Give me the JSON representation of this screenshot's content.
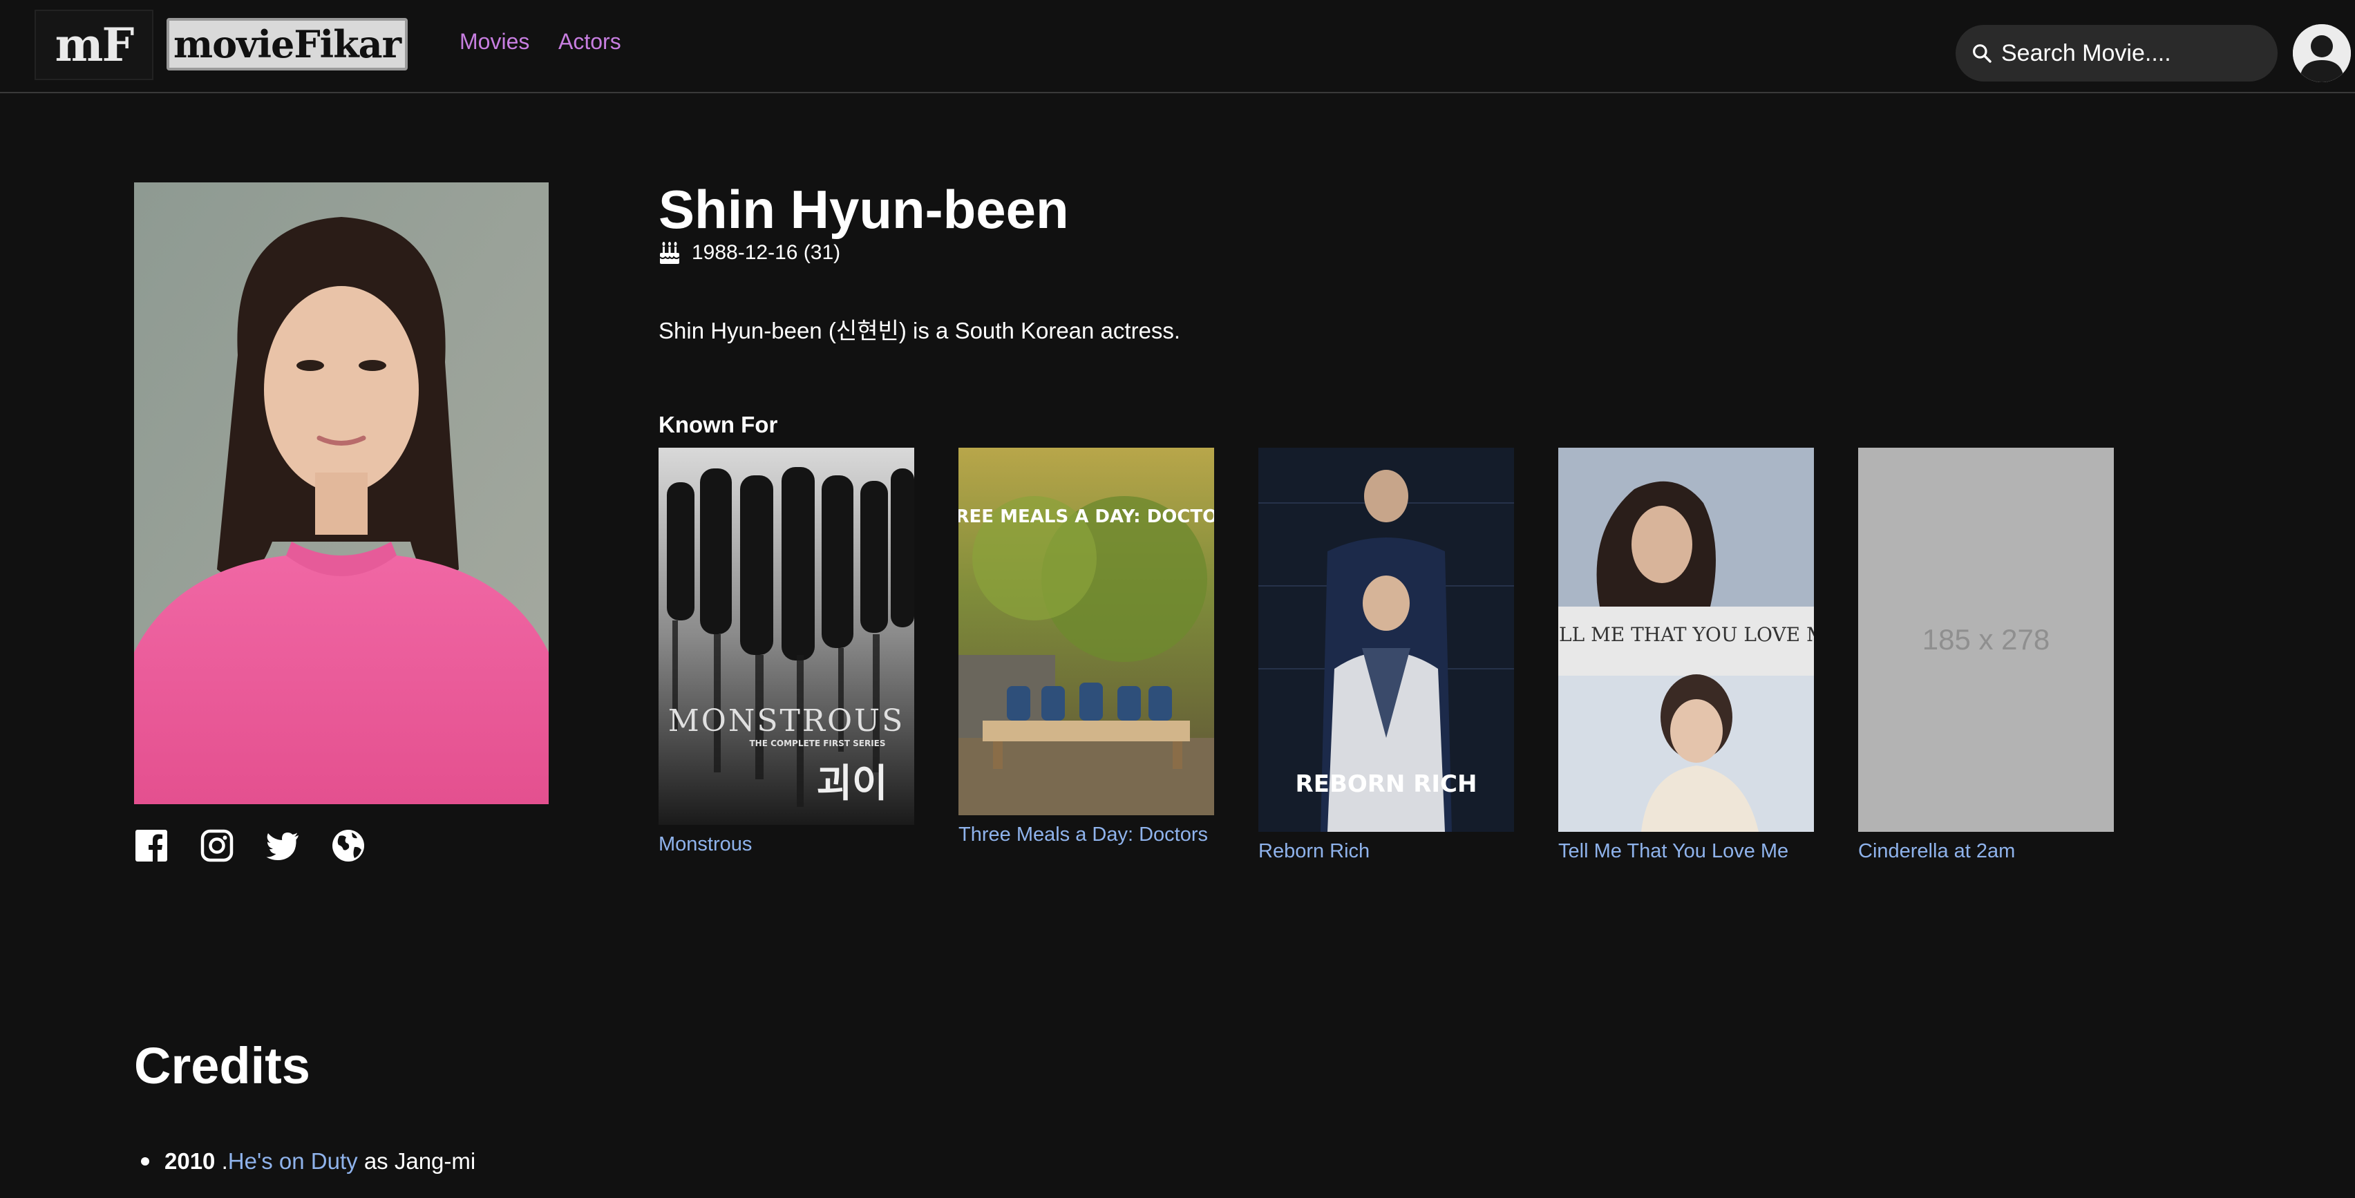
{
  "nav": {
    "logo_short": "mF",
    "logo_word": "movieFikar",
    "links": [
      "Movies",
      "Actors"
    ],
    "search_placeholder": "Search Movie....",
    "accent": "#c77ee0"
  },
  "actor": {
    "name": "Shin Hyun-been",
    "birth": "1988-12-16 (31)",
    "bio": "Shin Hyun-been (신현빈) is a South Korean actress.",
    "social_icons": [
      "facebook-icon",
      "instagram-icon",
      "twitter-icon",
      "globe-icon"
    ]
  },
  "known_for": {
    "heading": "Known For",
    "movies": [
      {
        "title": "Monstrous",
        "poster_text": "MONSTROUS",
        "poster_sub": "THE COMPLETE FIRST SERIES",
        "poster_korean": "괴이"
      },
      {
        "title": "Three Meals a Day: Doctors",
        "poster_text": "THREE MEALS A DAY: DOCTORS"
      },
      {
        "title": "Reborn Rich",
        "poster_text": "REBORN RICH"
      },
      {
        "title": "Tell Me That You Love Me",
        "poster_text": "TELL ME THAT YOU LOVE ME"
      },
      {
        "title": "Cinderella at 2am",
        "poster_text": "185 x 278"
      }
    ],
    "link_color": "#8fb3ec"
  },
  "credits": {
    "heading": "Credits",
    "items": [
      {
        "year": "2010",
        "sep": " .",
        "title": "He's on Duty",
        "role": " as Jang-mi"
      }
    ]
  }
}
